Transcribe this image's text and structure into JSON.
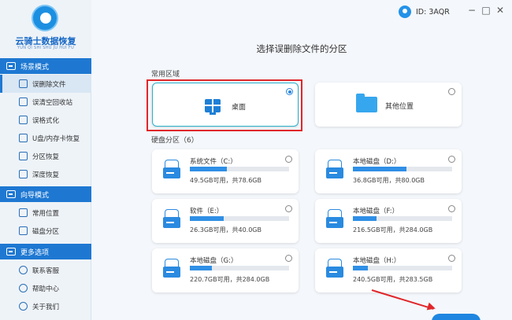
{
  "app": {
    "name": "云骑士数据恢复",
    "subtitle": "YUN QI SHI SHU JU HUI FU",
    "user_id": "ID: 3AQR",
    "minimize": "−",
    "maximize": "□",
    "close": "✕"
  },
  "sidebar": {
    "sections": [
      {
        "title": "场景模式",
        "items": [
          "误删除文件",
          "误清空回收站",
          "误格式化",
          "U盘/内存卡恢复",
          "分区恢复",
          "深度恢复"
        ]
      },
      {
        "title": "向导模式",
        "items": [
          "常用位置",
          "磁盘分区"
        ]
      },
      {
        "title": "更多选项",
        "items": [
          "联系客服",
          "帮助中心",
          "关于我们"
        ]
      }
    ],
    "active_item": "误删除文件"
  },
  "main": {
    "title": "选择误删除文件的分区",
    "common_label": "常用区域",
    "common": [
      {
        "label": "桌面",
        "selected": true
      },
      {
        "label": "其他位置",
        "selected": false
      }
    ],
    "disk_label": "硬盘分区（6）",
    "disks": [
      {
        "name": "系统文件（C:）",
        "size": "49.5GB可用，共78.6GB",
        "used_fraction": 0.37
      },
      {
        "name": "本地磁盘（D:）",
        "size": "36.8GB可用，共80.0GB",
        "used_fraction": 0.54
      },
      {
        "name": "软件（E:）",
        "size": "26.3GB可用，共40.0GB",
        "used_fraction": 0.34
      },
      {
        "name": "本地磁盘（F:）",
        "size": "216.5GB可用，共284.0GB",
        "used_fraction": 0.24
      },
      {
        "name": "本地磁盘（G:）",
        "size": "220.7GB可用，共284.0GB",
        "used_fraction": 0.22
      },
      {
        "name": "本地磁盘（H:）",
        "size": "240.5GB可用，共283.5GB",
        "used_fraction": 0.15
      }
    ]
  }
}
